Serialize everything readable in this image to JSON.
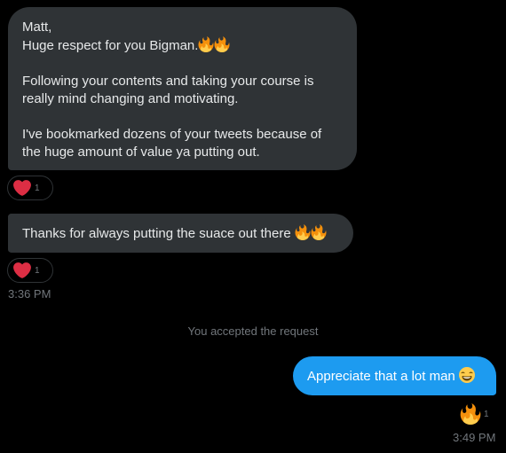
{
  "messages": [
    {
      "id": "msg1",
      "direction": "incoming",
      "lines": [
        "Matt,",
        "Huge respect for you Bigman.",
        "",
        "Following your contents and taking your course is",
        "really mind changing and motivating.",
        "",
        "I've bookmarked dozens of your tweets because of",
        "the huge amount of value ya putting out."
      ],
      "inline_emoji": [
        "fire-icon",
        "fire-icon"
      ],
      "reaction": {
        "icon": "heart-icon",
        "count": "1"
      }
    },
    {
      "id": "msg2",
      "direction": "incoming",
      "text": "Thanks for always putting the suace out there",
      "inline_emoji": [
        "fire-icon",
        "fire-icon"
      ],
      "reaction": {
        "icon": "heart-icon",
        "count": "1"
      },
      "timestamp": "3:36 PM"
    },
    {
      "id": "msg3",
      "direction": "outgoing",
      "text": "Appreciate that a lot man",
      "inline_emoji": [
        "grinning-face-icon"
      ],
      "reaction": {
        "icon": "fire-icon",
        "count": "1"
      },
      "timestamp": "3:49 PM"
    }
  ],
  "system_notice": "You accepted the request",
  "colors": {
    "background": "#000000",
    "incoming_bubble": "#2f3336",
    "outgoing_bubble": "#1d9bf0",
    "text": "#e7e9ea",
    "muted": "#71767b",
    "heart": "#f91880"
  }
}
